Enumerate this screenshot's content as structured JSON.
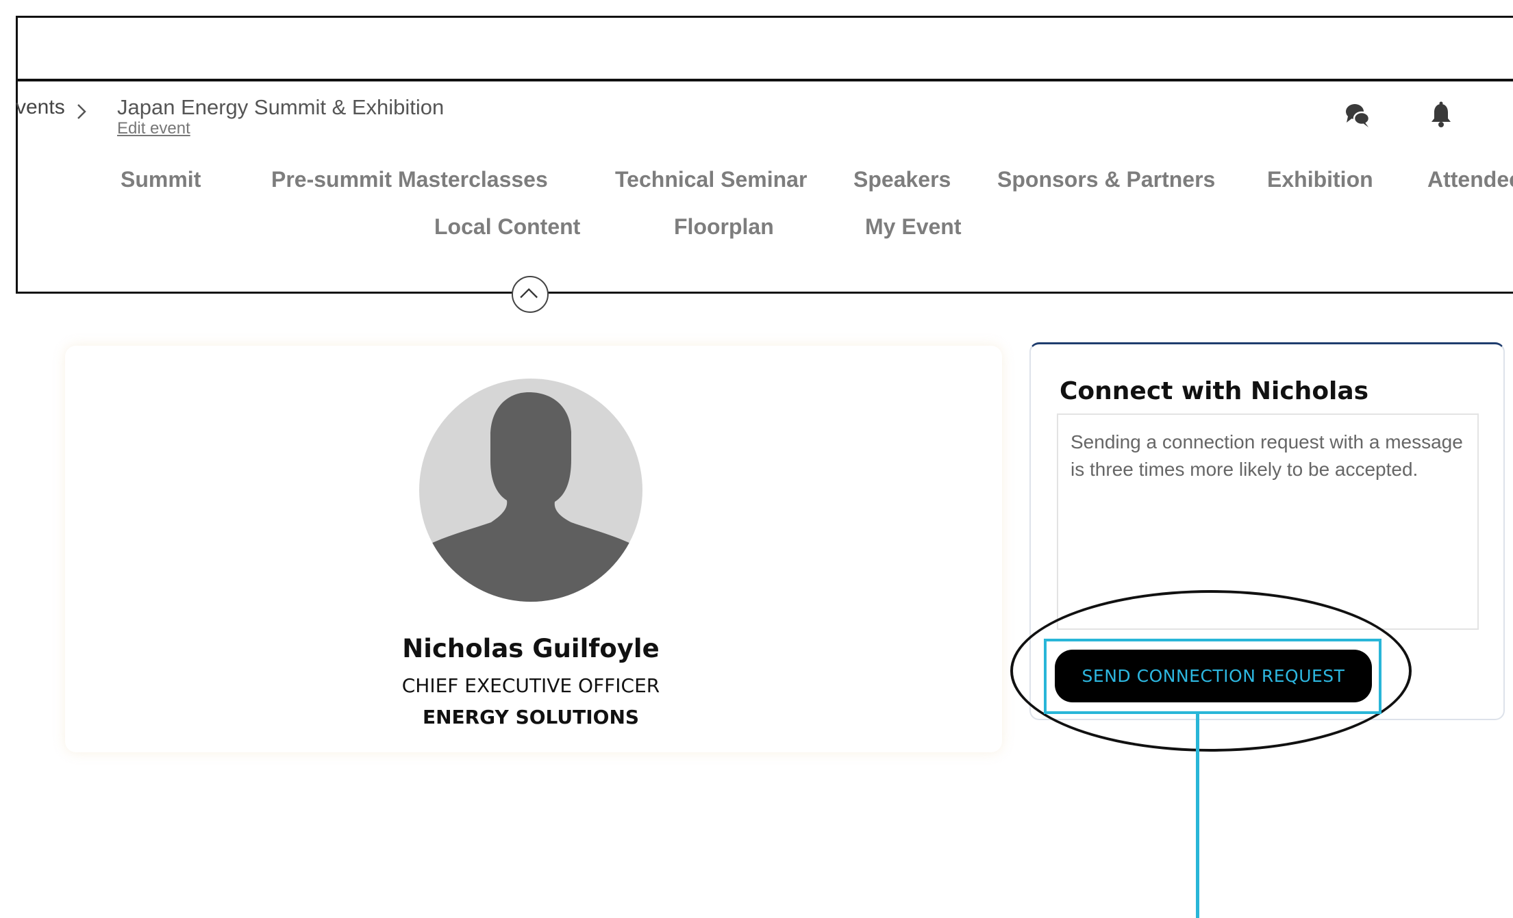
{
  "breadcrumb": {
    "prev_label": "vents",
    "event_title": "Japan Energy Summit & Exhibition",
    "edit_link": "Edit event"
  },
  "header_icons": [
    "chat-bubbles-icon",
    "bell-icon"
  ],
  "nav": {
    "row1": [
      "Summit",
      "Pre-summit Masterclasses",
      "Technical Seminar",
      "Speakers",
      "Sponsors & Partners",
      "Exhibition",
      "Attendee"
    ],
    "row2": [
      "Local Content",
      "Floorplan",
      "My Event"
    ]
  },
  "profile": {
    "name": "Nicholas Guilfoyle",
    "job_title": "CHIEF EXECUTIVE OFFICER",
    "company": "ENERGY SOLUTIONS"
  },
  "connect": {
    "title": "Connect with Nicholas",
    "message_value": "",
    "placeholder": "Sending a connection request with a message is three times more likely to be accepted.",
    "button_label": "SEND CONNECTION REQUEST"
  },
  "colors": {
    "annotation_blue": "#29b6d8",
    "button_bg": "#000000",
    "button_text": "#2db7e0",
    "nav_text": "#7d7d7d",
    "card_accent": "#1f3d6e",
    "avatar_bg": "#d6d6d6",
    "avatar_silhouette": "#5f5f5f"
  }
}
